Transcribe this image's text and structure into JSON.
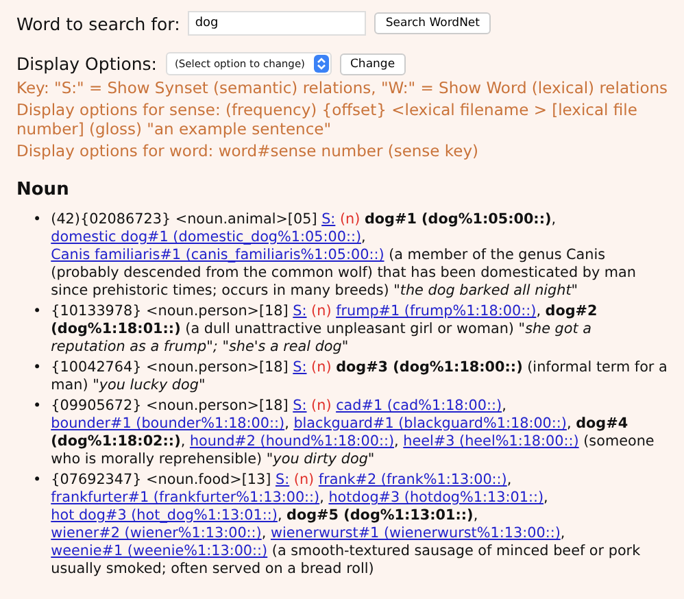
{
  "search": {
    "label": "Word to search for:",
    "value": "dog",
    "button": "Search WordNet"
  },
  "display": {
    "label": "Display Options:",
    "select": "(Select option to change)",
    "button": "Change"
  },
  "notes": [
    "Key: \"S:\" = Show Synset (semantic) relations, \"W:\" = Show Word (lexical) relations",
    "Display options for sense: (frequency) {offset} <lexical filename > [lexical file number] (gloss) \"an example sentence\"",
    "Display options for word: word#sense number (sense key)"
  ],
  "section": "Noun",
  "entries": [
    {
      "marker": "•",
      "segments": [
        {
          "kind": "text",
          "text": "(42){02086723} <noun.animal>[05] "
        },
        {
          "kind": "link",
          "text": "S:"
        },
        {
          "kind": "pos",
          "text": " (n) "
        },
        {
          "kind": "bold",
          "text": "dog#1 (dog%1:05:00::)"
        },
        {
          "kind": "text",
          "text": ", "
        },
        {
          "kind": "link",
          "text": "domestic dog#1 (domestic_dog%1:05:00::)"
        },
        {
          "kind": "text",
          "text": ", "
        },
        {
          "kind": "link",
          "text": "Canis familiaris#1 (canis_familiaris%1:05:00::)"
        },
        {
          "kind": "text",
          "text": " (a member of the genus Canis (probably descended from the common wolf) that has been domesticated by man since prehistoric times; occurs in many breeds) "
        },
        {
          "kind": "example",
          "text": "\"the dog barked all night\""
        }
      ]
    },
    {
      "marker": "•",
      "segments": [
        {
          "kind": "text",
          "text": "{10133978} <noun.person>[18] "
        },
        {
          "kind": "link",
          "text": "S:"
        },
        {
          "kind": "pos",
          "text": " (n) "
        },
        {
          "kind": "link",
          "text": "frump#1 (frump%1:18:00::)"
        },
        {
          "kind": "text",
          "text": ", "
        },
        {
          "kind": "bold",
          "text": "dog#2 (dog%1:18:01::)"
        },
        {
          "kind": "text",
          "text": " (a dull unattractive unpleasant girl or woman) "
        },
        {
          "kind": "example",
          "text": "\"she got a reputation as a frump\"; \"she's a real dog\""
        }
      ]
    },
    {
      "marker": "•",
      "segments": [
        {
          "kind": "text",
          "text": "{10042764} <noun.person>[18] "
        },
        {
          "kind": "link",
          "text": "S:"
        },
        {
          "kind": "pos",
          "text": " (n) "
        },
        {
          "kind": "bold",
          "text": "dog#3 (dog%1:18:00::)"
        },
        {
          "kind": "text",
          "text": " (informal term for a man) "
        },
        {
          "kind": "example",
          "text": "\"you lucky dog\""
        }
      ]
    },
    {
      "marker": "•",
      "segments": [
        {
          "kind": "text",
          "text": "{09905672} <noun.person>[18] "
        },
        {
          "kind": "link",
          "text": "S:"
        },
        {
          "kind": "pos",
          "text": " (n) "
        },
        {
          "kind": "link",
          "text": "cad#1 (cad%1:18:00::)"
        },
        {
          "kind": "text",
          "text": ", "
        },
        {
          "kind": "link",
          "text": "bounder#1 (bounder%1:18:00::)"
        },
        {
          "kind": "text",
          "text": ", "
        },
        {
          "kind": "link",
          "text": "blackguard#1 (blackguard%1:18:00::)"
        },
        {
          "kind": "text",
          "text": ", "
        },
        {
          "kind": "bold",
          "text": "dog#4 (dog%1:18:02::)"
        },
        {
          "kind": "text",
          "text": ", "
        },
        {
          "kind": "link",
          "text": "hound#2 (hound%1:18:00::)"
        },
        {
          "kind": "text",
          "text": ", "
        },
        {
          "kind": "link",
          "text": "heel#3 (heel%1:18:00::)"
        },
        {
          "kind": "text",
          "text": " (someone who is morally reprehensible) "
        },
        {
          "kind": "example",
          "text": "\"you dirty dog\""
        }
      ]
    },
    {
      "marker": "•",
      "segments": [
        {
          "kind": "text",
          "text": "{07692347} <noun.food>[13] "
        },
        {
          "kind": "link",
          "text": "S:"
        },
        {
          "kind": "pos",
          "text": " (n) "
        },
        {
          "kind": "link",
          "text": "frank#2 (frank%1:13:00::)"
        },
        {
          "kind": "text",
          "text": ", "
        },
        {
          "kind": "link",
          "text": "frankfurter#1 (frankfurter%1:13:00::)"
        },
        {
          "kind": "text",
          "text": ", "
        },
        {
          "kind": "link",
          "text": "hotdog#3 (hotdog%1:13:01::)"
        },
        {
          "kind": "text",
          "text": ", "
        },
        {
          "kind": "link",
          "text": "hot dog#3 (hot_dog%1:13:01::)"
        },
        {
          "kind": "text",
          "text": ", "
        },
        {
          "kind": "bold",
          "text": "dog#5 (dog%1:13:01::)"
        },
        {
          "kind": "text",
          "text": ", "
        },
        {
          "kind": "link",
          "text": "wiener#2 (wiener%1:13:00::)"
        },
        {
          "kind": "text",
          "text": ", "
        },
        {
          "kind": "link",
          "text": "wienerwurst#1 (wienerwurst%1:13:00::)"
        },
        {
          "kind": "text",
          "text": ", "
        },
        {
          "kind": "link",
          "text": "weenie#1 (weenie%1:13:00::)"
        },
        {
          "kind": "text",
          "text": " (a smooth-textured sausage of minced beef or pork usually smoked; often served on a bread roll)"
        }
      ]
    }
  ]
}
